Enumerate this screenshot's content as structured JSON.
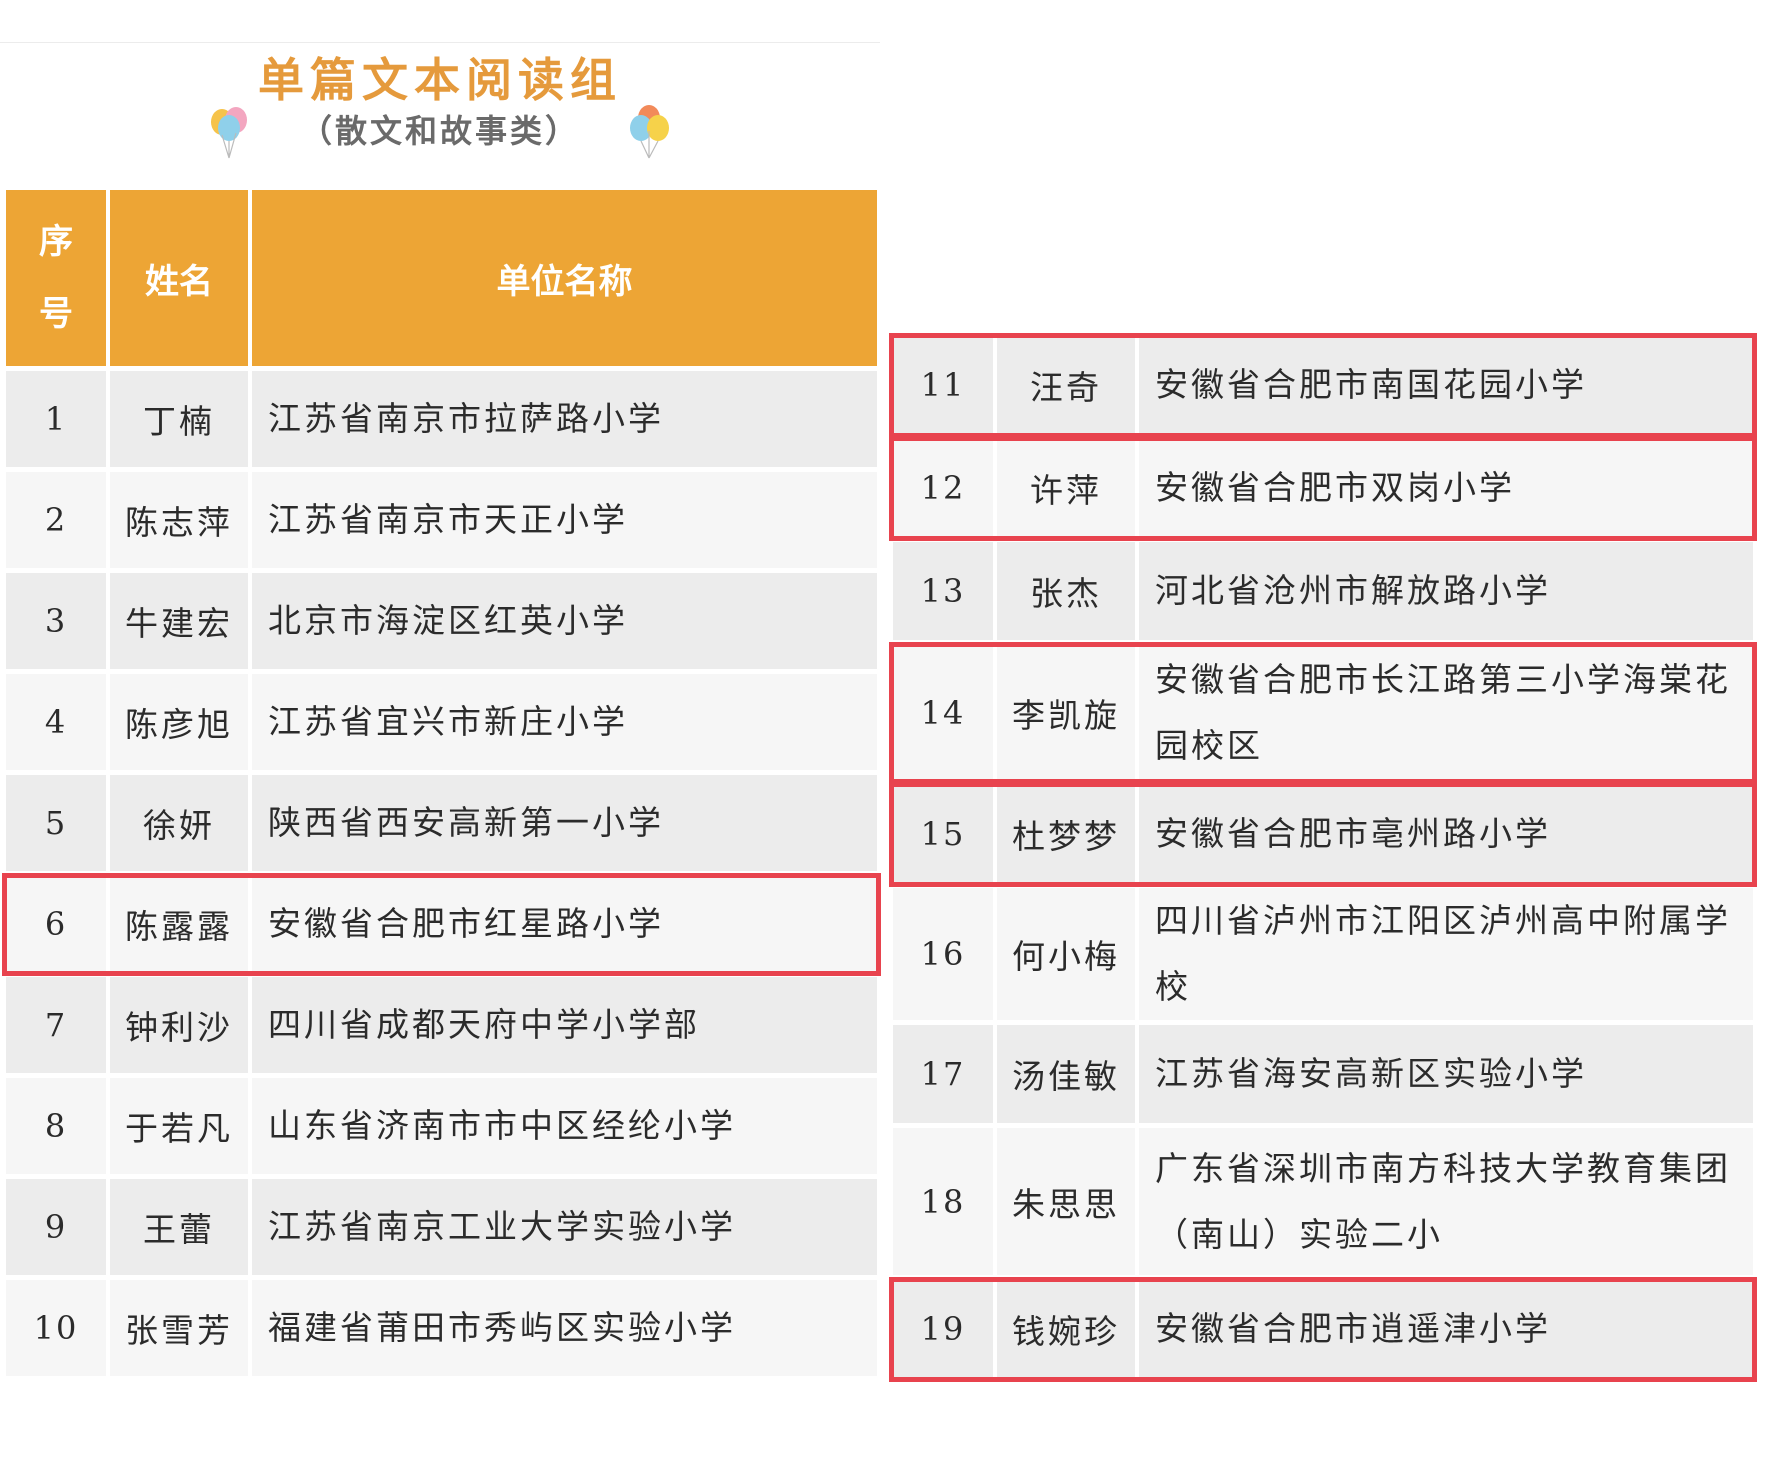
{
  "title": "单篇文本阅读组",
  "subtitle": "（散文和故事类）",
  "icons": {
    "balloons": "balloon-cluster-icon"
  },
  "colors": {
    "header_bg": "#eda535",
    "title": "#e59a3c",
    "highlight": "#e8434e"
  },
  "table": {
    "headers": {
      "index": "序号",
      "name": "姓名",
      "unit": "单位名称"
    },
    "rows": [
      {
        "index": "1",
        "name": "丁楠",
        "unit": "江苏省南京市拉萨路小学",
        "highlighted": false
      },
      {
        "index": "2",
        "name": "陈志萍",
        "unit": "江苏省南京市天正小学",
        "highlighted": false
      },
      {
        "index": "3",
        "name": "牛建宏",
        "unit": "北京市海淀区红英小学",
        "highlighted": false
      },
      {
        "index": "4",
        "name": "陈彦旭",
        "unit": "江苏省宜兴市新庄小学",
        "highlighted": false
      },
      {
        "index": "5",
        "name": "徐妍",
        "unit": "陕西省西安高新第一小学",
        "highlighted": false
      },
      {
        "index": "6",
        "name": "陈露露",
        "unit": "安徽省合肥市红星路小学",
        "highlighted": true
      },
      {
        "index": "7",
        "name": "钟利沙",
        "unit": "四川省成都天府中学小学部",
        "highlighted": false
      },
      {
        "index": "8",
        "name": "于若凡",
        "unit": "山东省济南市市中区经纶小学",
        "highlighted": false
      },
      {
        "index": "9",
        "name": "王蕾",
        "unit": "江苏省南京工业大学实验小学",
        "highlighted": false
      },
      {
        "index": "10",
        "name": "张雪芳",
        "unit": "福建省莆田市秀屿区实验小学",
        "highlighted": false
      },
      {
        "index": "11",
        "name": "汪奇",
        "unit": "安徽省合肥市南国花园小学",
        "highlighted": true
      },
      {
        "index": "12",
        "name": "许萍",
        "unit": "安徽省合肥市双岗小学",
        "highlighted": true
      },
      {
        "index": "13",
        "name": "张杰",
        "unit": "河北省沧州市解放路小学",
        "highlighted": false
      },
      {
        "index": "14",
        "name": "李凯旋",
        "unit": "安徽省合肥市长江路第三小学海棠花园校区",
        "highlighted": true
      },
      {
        "index": "15",
        "name": "杜梦梦",
        "unit": "安徽省合肥市亳州路小学",
        "highlighted": true
      },
      {
        "index": "16",
        "name": "何小梅",
        "unit": "四川省泸州市江阳区泸州高中附属学校",
        "highlighted": false
      },
      {
        "index": "17",
        "name": "汤佳敏",
        "unit": "江苏省海安高新区实验小学",
        "highlighted": false
      },
      {
        "index": "18",
        "name": "朱思思",
        "unit": "广东省深圳市南方科技大学教育集团（南山）实验二小",
        "highlighted": false
      },
      {
        "index": "19",
        "name": "钱婉珍",
        "unit": "安徽省合肥市逍遥津小学",
        "highlighted": true
      }
    ]
  }
}
